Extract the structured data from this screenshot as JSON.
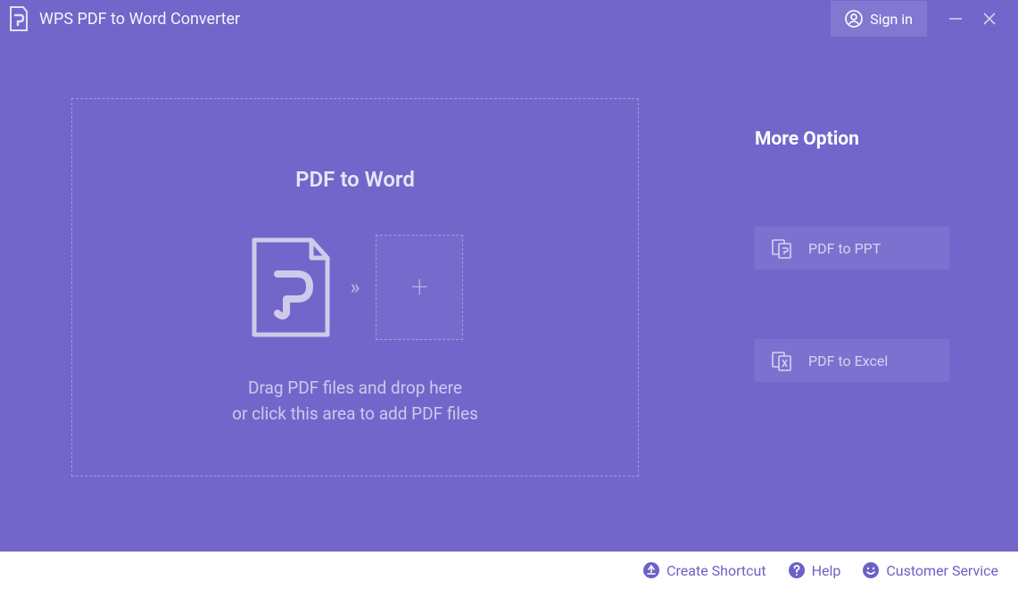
{
  "titlebar": {
    "app_title": "WPS PDF to Word Converter",
    "signin_label": "Sign in"
  },
  "dropzone": {
    "title": "PDF to Word",
    "instruction_line1": "Drag PDF files and drop here",
    "instruction_line2": "or click this area to add PDF files"
  },
  "side": {
    "title": "More Option",
    "options": [
      {
        "label": "PDF to PPT"
      },
      {
        "label": "PDF to Excel"
      }
    ]
  },
  "footer": {
    "create_shortcut": "Create Shortcut",
    "help": "Help",
    "customer_service": "Customer Service"
  }
}
